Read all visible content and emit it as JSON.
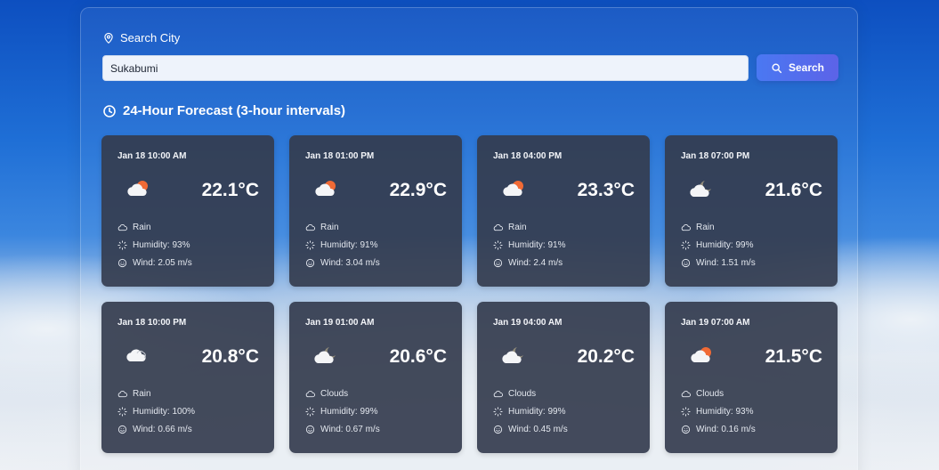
{
  "search": {
    "label": "Search City",
    "value": "Sukabumi",
    "button_label": "Search"
  },
  "forecast": {
    "title": "24-Hour Forecast (3-hour intervals)",
    "items": [
      {
        "time": "Jan 18 10:00 AM",
        "temp": "22.1°C",
        "condition": "Rain",
        "humidity": "Humidity: 93%",
        "wind": "Wind: 2.05 m/s",
        "icon": "sun-cloud-icon"
      },
      {
        "time": "Jan 18 01:00 PM",
        "temp": "22.9°C",
        "condition": "Rain",
        "humidity": "Humidity: 91%",
        "wind": "Wind: 3.04 m/s",
        "icon": "sun-cloud-icon"
      },
      {
        "time": "Jan 18 04:00 PM",
        "temp": "23.3°C",
        "condition": "Rain",
        "humidity": "Humidity: 91%",
        "wind": "Wind: 2.4 m/s",
        "icon": "sun-cloud-icon"
      },
      {
        "time": "Jan 18 07:00 PM",
        "temp": "21.6°C",
        "condition": "Rain",
        "humidity": "Humidity: 99%",
        "wind": "Wind: 1.51 m/s",
        "icon": "moon-cloud-icon"
      },
      {
        "time": "Jan 18 10:00 PM",
        "temp": "20.8°C",
        "condition": "Rain",
        "humidity": "Humidity: 100%",
        "wind": "Wind: 0.66 m/s",
        "icon": "cloud-icon"
      },
      {
        "time": "Jan 19 01:00 AM",
        "temp": "20.6°C",
        "condition": "Clouds",
        "humidity": "Humidity: 99%",
        "wind": "Wind: 0.67 m/s",
        "icon": "moon-cloud-icon"
      },
      {
        "time": "Jan 19 04:00 AM",
        "temp": "20.2°C",
        "condition": "Clouds",
        "humidity": "Humidity: 99%",
        "wind": "Wind: 0.45 m/s",
        "icon": "moon-cloud-icon"
      },
      {
        "time": "Jan 19 07:00 AM",
        "temp": "21.5°C",
        "condition": "Clouds",
        "humidity": "Humidity: 93%",
        "wind": "Wind: 0.16 m/s",
        "icon": "sun-cloud-icon"
      }
    ]
  }
}
